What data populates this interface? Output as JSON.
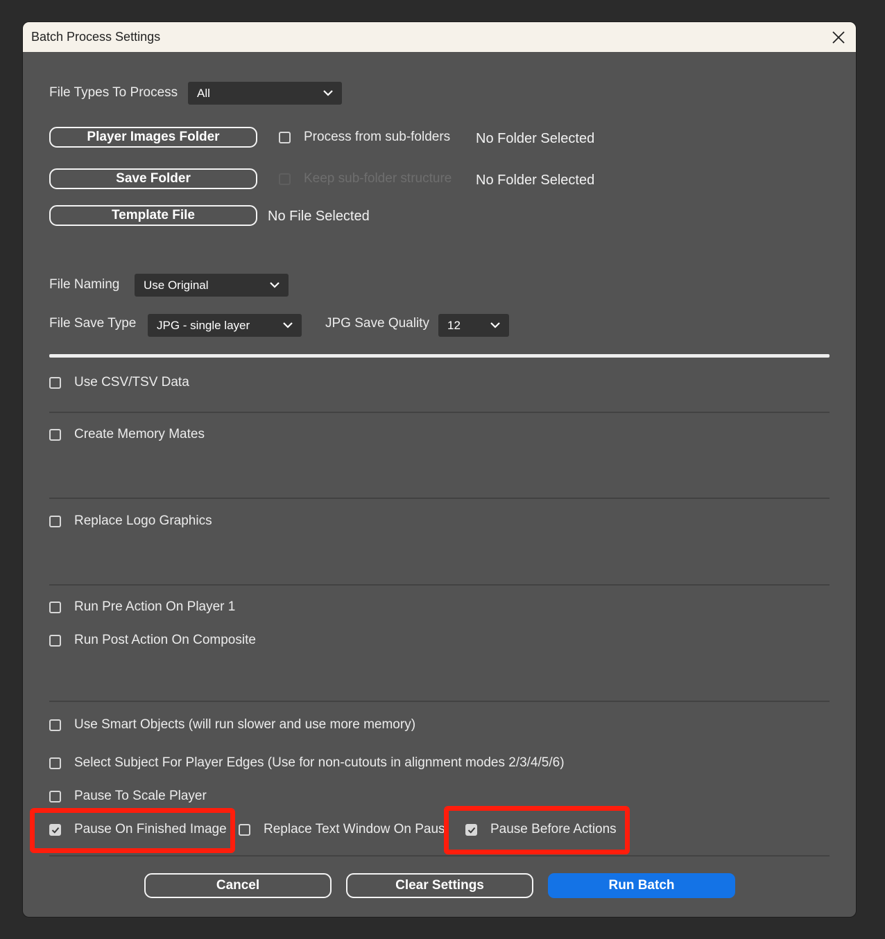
{
  "dialog": {
    "title": "Batch Process Settings"
  },
  "file_types": {
    "label": "File Types To Process",
    "value": "All"
  },
  "player_images_folder": {
    "button": "Player Images Folder",
    "subfolders_label": "Process from sub-folders",
    "subfolders_checked": false,
    "status": "No Folder Selected"
  },
  "save_folder": {
    "button": "Save Folder",
    "keep_structure_label": "Keep sub-folder structure",
    "keep_structure_enabled": false,
    "status": "No Folder Selected"
  },
  "template_file": {
    "button": "Template File",
    "status": "No File Selected"
  },
  "file_naming": {
    "label": "File Naming",
    "value": "Use Original"
  },
  "file_save_type": {
    "label": "File Save Type",
    "value": "JPG - single layer"
  },
  "jpg_quality": {
    "label": "JPG Save Quality",
    "value": "12"
  },
  "options": {
    "use_csv": {
      "label": "Use CSV/TSV Data",
      "checked": false
    },
    "memory_mates": {
      "label": "Create Memory Mates",
      "checked": false
    },
    "replace_logo": {
      "label": "Replace Logo Graphics",
      "checked": false
    },
    "pre_action": {
      "label": "Run Pre Action On Player 1",
      "checked": false
    },
    "post_action": {
      "label": "Run Post Action On Composite",
      "checked": false
    },
    "smart_objects": {
      "label": "Use Smart Objects (will run slower and use more memory)",
      "checked": false
    },
    "select_subject": {
      "label": "Select Subject For Player Edges (Use for non-cutouts in alignment modes 2/3/4/5/6)",
      "checked": false
    },
    "pause_scale": {
      "label": "Pause To Scale Player",
      "checked": false
    },
    "pause_finished": {
      "label": "Pause On Finished Image",
      "checked": true
    },
    "replace_text_window": {
      "label": "Replace Text Window On Pause",
      "checked": false
    },
    "pause_before_actions": {
      "label": "Pause Before Actions",
      "checked": true
    }
  },
  "footer": {
    "cancel": "Cancel",
    "clear": "Clear Settings",
    "run": "Run Batch"
  },
  "colors": {
    "dialog_bg": "#535353",
    "titlebar_bg": "#f6f2ea",
    "primary": "#1473e6",
    "highlight": "#ff1d0c"
  }
}
